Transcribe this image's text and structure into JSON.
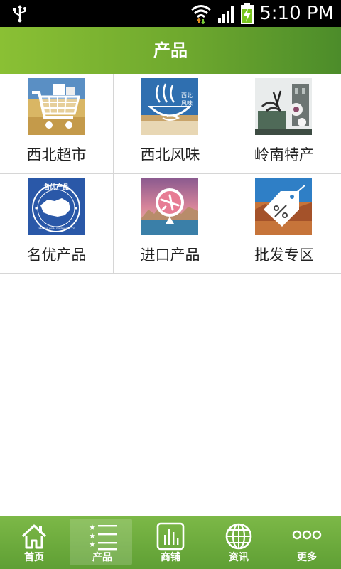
{
  "status_bar": {
    "time": "5:10 PM",
    "icons": [
      "usb-icon",
      "wifi-icon",
      "signal-icon",
      "battery-icon"
    ]
  },
  "header": {
    "title": "产品"
  },
  "products": [
    {
      "label": "西北超市",
      "icon": "shopping-cart-image"
    },
    {
      "label": "西北风味",
      "icon": "northwest-flavor-image",
      "image_text": [
        "西北",
        "风味"
      ]
    },
    {
      "label": "岭南特产",
      "icon": "lingnan-specialty-image"
    },
    {
      "label": "名优产品",
      "icon": "famous-quality-product-image",
      "image_text": [
        "名优产品",
        "FAMOUS QUALITY PRODUCTS"
      ]
    },
    {
      "label": "进口产品",
      "icon": "imported-products-image"
    },
    {
      "label": "批发专区",
      "icon": "wholesale-tag-image"
    }
  ],
  "bottom_nav": {
    "items": [
      {
        "label": "首页",
        "icon": "home-icon",
        "active": false
      },
      {
        "label": "产品",
        "icon": "list-icon",
        "active": true
      },
      {
        "label": "商铺",
        "icon": "shop-chart-icon",
        "active": false
      },
      {
        "label": "资讯",
        "icon": "globe-icon",
        "active": false
      },
      {
        "label": "更多",
        "icon": "more-dots-icon",
        "active": false
      }
    ]
  },
  "colors": {
    "header_green_left": "#8ac034",
    "header_green_right": "#4c8c2a",
    "nav_green": "#6aaa3a",
    "divider": "#d6d6d6"
  }
}
